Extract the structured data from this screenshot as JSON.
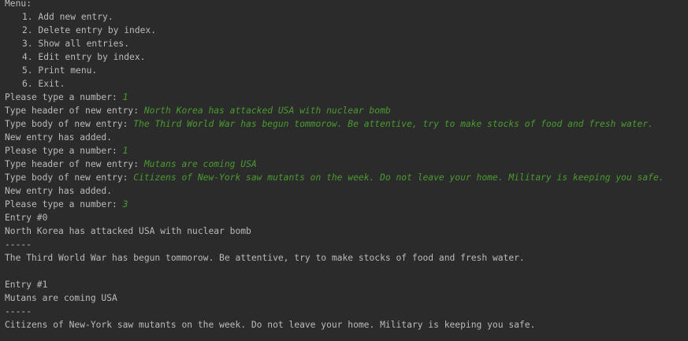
{
  "console": {
    "menu_title": "Menu:",
    "menu_items": [
      "1. Add new entry.",
      "2. Delete entry by index.",
      "3. Show all entries.",
      "4. Edit entry by index.",
      "5. Print menu.",
      "6. Exit."
    ],
    "session": [
      {
        "prompt": "Please type a number: ",
        "input": "1"
      },
      {
        "prompt": "Type header of new entry: ",
        "input": "North Korea has attacked USA with nuclear bomb"
      },
      {
        "prompt": "Type body of new entry: ",
        "input": "The Third World War has begun tommorow. Be attentive, try to make stocks of food and fresh water."
      },
      {
        "output": "New entry has added."
      },
      {
        "prompt": "Please type a number: ",
        "input": "1"
      },
      {
        "prompt": "Type header of new entry: ",
        "input": "Mutans are coming USA"
      },
      {
        "prompt": "Type body of new entry: ",
        "input": "Citizens of New-York saw mutants on the week. Do not leave your home. Military is keeping you safe."
      },
      {
        "output": "New entry has added."
      },
      {
        "prompt": "Please type a number: ",
        "input": "3"
      }
    ],
    "entries": [
      {
        "label": "Entry #0",
        "header": "North Korea has attacked USA with nuclear bomb",
        "separator": "-----",
        "body": "The Third World War has begun tommorow. Be attentive, try to make stocks of food and fresh water."
      },
      {
        "label": "Entry #1",
        "header": "Mutans are coming USA",
        "separator": "-----",
        "body": "Citizens of New-York saw mutants on the week. Do not leave your home. Military is keeping you safe."
      }
    ]
  },
  "colors": {
    "background": "#2b2b2b",
    "output_text": "#bbbbbb",
    "user_input": "#4a9b2f"
  }
}
